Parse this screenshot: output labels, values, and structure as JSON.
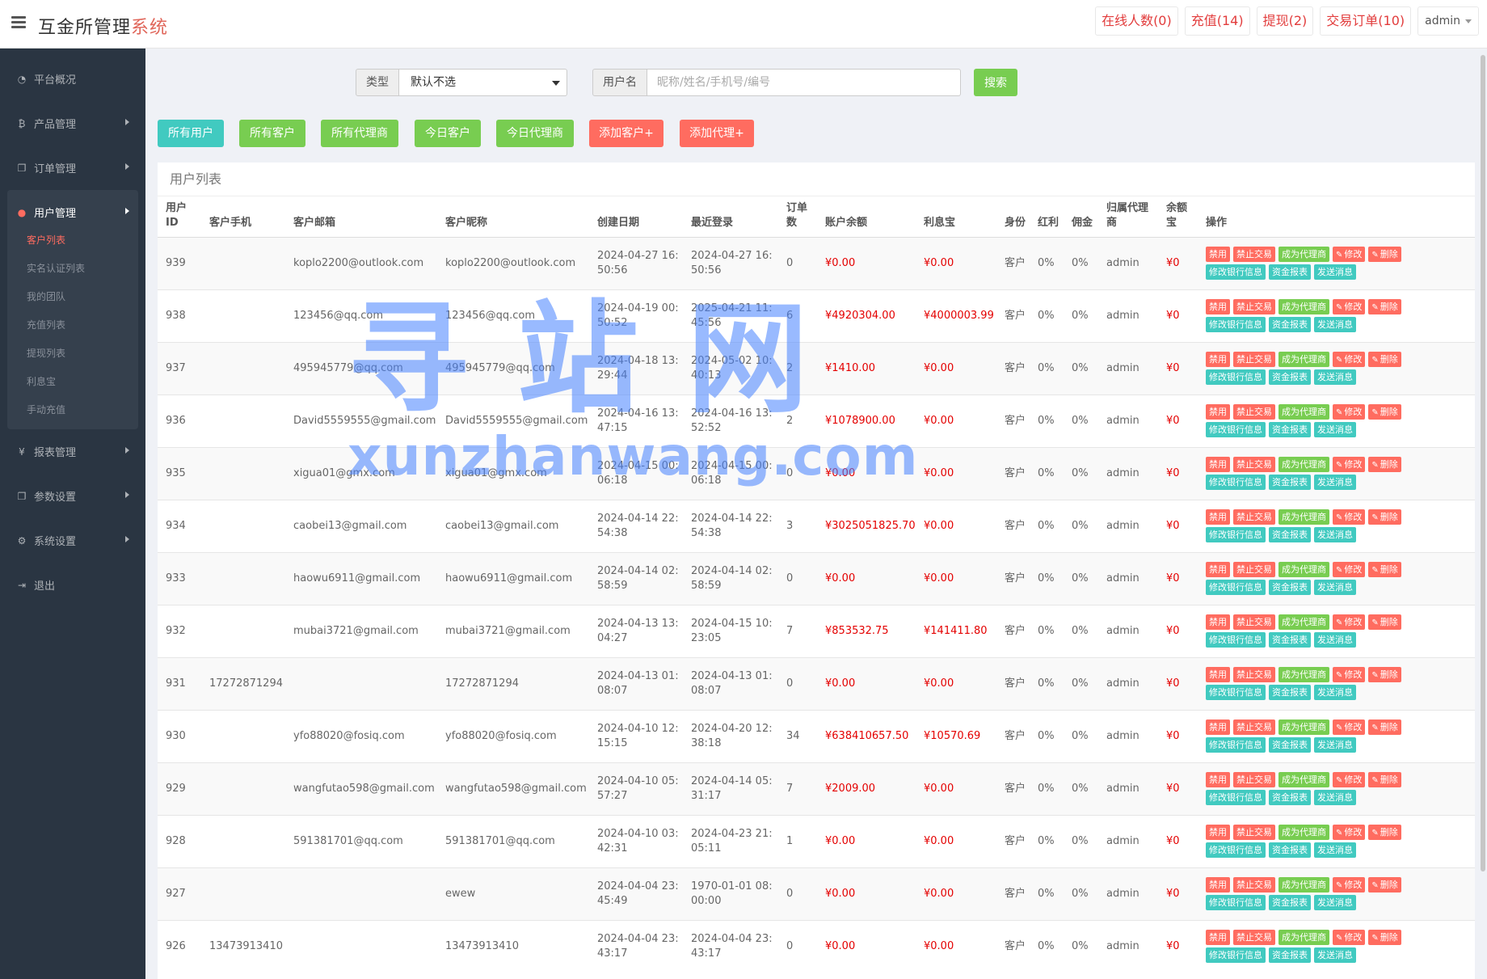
{
  "header": {
    "brand_main": "互金所管理",
    "brand_accent": "系统",
    "online": "在线人数(0)",
    "recharge": "充值(14)",
    "withdraw": "提现(2)",
    "orders": "交易订单(10)",
    "user": "admin"
  },
  "sidebar": {
    "overview": "平台概况",
    "products": "产品管理",
    "orders": "订单管理",
    "users": "用户管理",
    "user_sub": [
      "客户列表",
      "实名认证列表",
      "我的团队",
      "充值列表",
      "提现列表",
      "利息宝",
      "手动充值"
    ],
    "reports": "报表管理",
    "params": "参数设置",
    "system": "系统设置",
    "logout": "退出"
  },
  "filter": {
    "type_label": "类型",
    "type_value": "默认不选",
    "username_label": "用户名",
    "username_placeholder": "昵称/姓名/手机号/编号",
    "search": "搜索"
  },
  "actions": [
    "所有用户",
    "所有客户",
    "所有代理商",
    "今日客户",
    "今日代理商",
    "添加客户+",
    "添加代理+"
  ],
  "panel_title": "用户列表",
  "columns": [
    "用户ID",
    "客户手机",
    "客户邮箱",
    "客户昵称",
    "创建日期",
    "最近登录",
    "订单数",
    "账户余额",
    "利息宝",
    "身份",
    "红利",
    "佣金",
    "归属代理商",
    "余额宝",
    "操作"
  ],
  "op_labels": [
    "禁用",
    "禁止交易",
    "成为代理商",
    "修改",
    "删除",
    "修改银行信息",
    "资金报表",
    "发送消息"
  ],
  "rows": [
    {
      "id": "939",
      "phone": "",
      "email": "koplo2200@outlook.com",
      "nick": "koplo2200@outlook.com",
      "created": "2024-04-27 16:50:56",
      "last": "2024-04-27 16:50:56",
      "orders": "0",
      "balance": "¥0.00",
      "interest": "¥0.00",
      "role": "客户",
      "bonus": "0%",
      "comm": "0%",
      "agent": "admin",
      "yeb": "¥0"
    },
    {
      "id": "938",
      "phone": "",
      "email": "123456@qq.com",
      "nick": "123456@qq.com",
      "created": "2024-04-19 00:50:52",
      "last": "2025-04-21 11:45:56",
      "orders": "6",
      "balance": "¥4920304.00",
      "interest": "¥4000003.99",
      "role": "客户",
      "bonus": "0%",
      "comm": "0%",
      "agent": "admin",
      "yeb": "¥0"
    },
    {
      "id": "937",
      "phone": "",
      "email": "495945779@qq.com",
      "nick": "495945779@qq.com",
      "created": "2024-04-18 13:29:44",
      "last": "2024-05-02 10:40:13",
      "orders": "2",
      "balance": "¥1410.00",
      "interest": "¥0.00",
      "role": "客户",
      "bonus": "0%",
      "comm": "0%",
      "agent": "admin",
      "yeb": "¥0"
    },
    {
      "id": "936",
      "phone": "",
      "email": "David5559555@gmail.com",
      "nick": "David5559555@gmail.com",
      "created": "2024-04-16 13:47:15",
      "last": "2024-04-16 13:52:52",
      "orders": "2",
      "balance": "¥1078900.00",
      "interest": "¥0.00",
      "role": "客户",
      "bonus": "0%",
      "comm": "0%",
      "agent": "admin",
      "yeb": "¥0"
    },
    {
      "id": "935",
      "phone": "",
      "email": "xigua01@gmx.com",
      "nick": "xigua01@gmx.com",
      "created": "2024-04-15 00:06:18",
      "last": "2024-04-15 00:06:18",
      "orders": "0",
      "balance": "¥0.00",
      "interest": "¥0.00",
      "role": "客户",
      "bonus": "0%",
      "comm": "0%",
      "agent": "admin",
      "yeb": "¥0"
    },
    {
      "id": "934",
      "phone": "",
      "email": "caobei13@gmail.com",
      "nick": "caobei13@gmail.com",
      "created": "2024-04-14 22:54:38",
      "last": "2024-04-14 22:54:38",
      "orders": "3",
      "balance": "¥3025051825.70",
      "interest": "¥0.00",
      "role": "客户",
      "bonus": "0%",
      "comm": "0%",
      "agent": "admin",
      "yeb": "¥0"
    },
    {
      "id": "933",
      "phone": "",
      "email": "haowu6911@gmail.com",
      "nick": "haowu6911@gmail.com",
      "created": "2024-04-14 02:58:59",
      "last": "2024-04-14 02:58:59",
      "orders": "0",
      "balance": "¥0.00",
      "interest": "¥0.00",
      "role": "客户",
      "bonus": "0%",
      "comm": "0%",
      "agent": "admin",
      "yeb": "¥0"
    },
    {
      "id": "932",
      "phone": "",
      "email": "mubai3721@gmail.com",
      "nick": "mubai3721@gmail.com",
      "created": "2024-04-13 13:04:27",
      "last": "2024-04-15 10:23:05",
      "orders": "7",
      "balance": "¥853532.75",
      "interest": "¥141411.80",
      "role": "客户",
      "bonus": "0%",
      "comm": "0%",
      "agent": "admin",
      "yeb": "¥0"
    },
    {
      "id": "931",
      "phone": "17272871294",
      "email": "",
      "nick": "17272871294",
      "created": "2024-04-13 01:08:07",
      "last": "2024-04-13 01:08:07",
      "orders": "0",
      "balance": "¥0.00",
      "interest": "¥0.00",
      "role": "客户",
      "bonus": "0%",
      "comm": "0%",
      "agent": "admin",
      "yeb": "¥0"
    },
    {
      "id": "930",
      "phone": "",
      "email": "yfo88020@fosiq.com",
      "nick": "yfo88020@fosiq.com",
      "created": "2024-04-10 12:15:15",
      "last": "2024-04-20 12:38:18",
      "orders": "34",
      "balance": "¥638410657.50",
      "interest": "¥10570.69",
      "role": "客户",
      "bonus": "0%",
      "comm": "0%",
      "agent": "admin",
      "yeb": "¥0"
    },
    {
      "id": "929",
      "phone": "",
      "email": "wangfutao598@gmail.com",
      "nick": "wangfutao598@gmail.com",
      "created": "2024-04-10 05:57:27",
      "last": "2024-04-14 05:31:17",
      "orders": "7",
      "balance": "¥2009.00",
      "interest": "¥0.00",
      "role": "客户",
      "bonus": "0%",
      "comm": "0%",
      "agent": "admin",
      "yeb": "¥0"
    },
    {
      "id": "928",
      "phone": "",
      "email": "591381701@qq.com",
      "nick": "591381701@qq.com",
      "created": "2024-04-10 03:42:31",
      "last": "2024-04-23 21:05:11",
      "orders": "1",
      "balance": "¥0.00",
      "interest": "¥0.00",
      "role": "客户",
      "bonus": "0%",
      "comm": "0%",
      "agent": "admin",
      "yeb": "¥0"
    },
    {
      "id": "927",
      "phone": "",
      "email": "",
      "nick": "ewew",
      "created": "2024-04-04 23:45:49",
      "last": "1970-01-01 08:00:00",
      "orders": "0",
      "balance": "¥0.00",
      "interest": "¥0.00",
      "role": "客户",
      "bonus": "0%",
      "comm": "0%",
      "agent": "admin",
      "yeb": "¥0"
    },
    {
      "id": "926",
      "phone": "13473913410",
      "email": "",
      "nick": "13473913410",
      "created": "2024-04-04 23:43:17",
      "last": "2024-04-04 23:43:17",
      "orders": "0",
      "balance": "¥0.00",
      "interest": "¥0.00",
      "role": "客户",
      "bonus": "0%",
      "comm": "0%",
      "agent": "admin",
      "yeb": "¥0"
    }
  ],
  "watermark": {
    "cn": "寻站网",
    "en": "xunzhanwang.com"
  },
  "colors": {
    "sidebar": "#2a3542",
    "accent_red": "#ff6c60",
    "green": "#78cd51",
    "cyan": "#41cac0",
    "money": "#e40000"
  }
}
